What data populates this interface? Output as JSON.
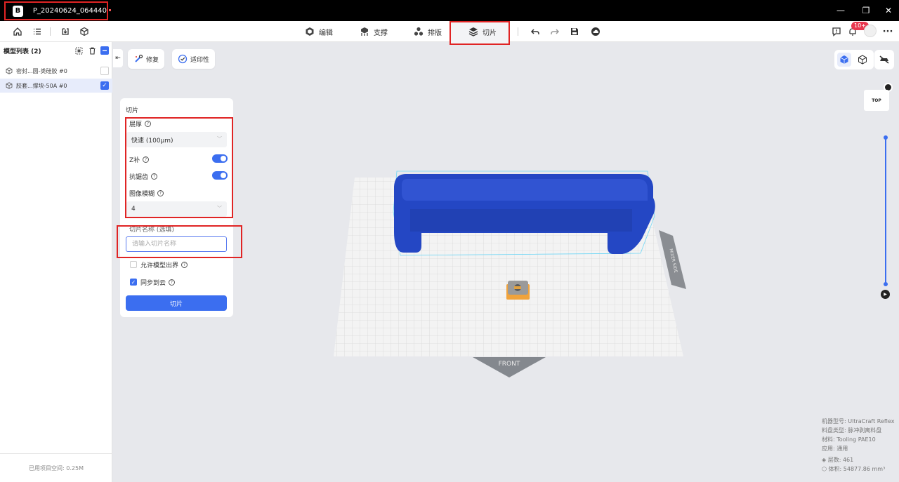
{
  "window": {
    "title": "P_20240624_064440",
    "logo": "B",
    "min_label": "—",
    "max_label": "❐",
    "close_label": "✕"
  },
  "toolbar": {
    "tabs": [
      {
        "label": "编辑",
        "icon": "edit-icon"
      },
      {
        "label": "支撑",
        "icon": "support-icon"
      },
      {
        "label": "排版",
        "icon": "layout-icon"
      },
      {
        "label": "切片",
        "icon": "slice-icon",
        "active": true
      }
    ],
    "notification_count": "10+",
    "more_label": "···"
  },
  "sidebar": {
    "title": "模型列表 (2)",
    "items": [
      {
        "label": "密封...圆-类硅胶 #0",
        "checked": false
      },
      {
        "label": "胶套...撑块-50A #0",
        "checked": true
      }
    ],
    "footer": "已用项目空间: 0.25M"
  },
  "actions": {
    "repair_label": "修复",
    "printability_label": "适印性"
  },
  "slice_panel": {
    "title": "切片",
    "layer_thickness_label": "层厚",
    "layer_thickness_value": "快速 (100μm)",
    "z_comp_label": "Z补",
    "z_comp_on": true,
    "antialias_label": "抗锯齿",
    "antialias_on": true,
    "image_blur_label": "图像模糊",
    "image_blur_value": "4",
    "slice_name_label": "切片名称 (选填)",
    "slice_name_placeholder": "请输入切片名称",
    "slice_name_value": "",
    "allow_out_of_bounds_label": "允许模型出界",
    "allow_out_of_bounds": false,
    "sync_cloud_label": "同步到云",
    "sync_cloud": true,
    "slice_button": "切片"
  },
  "viewport": {
    "front_label": "FRONT",
    "side_label": "MIXER SIDE",
    "cube_label": "TOP",
    "model_color": "#2447c4",
    "accent": "#3b6ef0"
  },
  "info": {
    "machine_label": "机器型号:",
    "machine_value": "UltraCraft Reflex",
    "tray_label": "料盘类型:",
    "tray_value": "脉冲剥离料盘",
    "material_label": "材料:",
    "material_value": "Tooling PAE10",
    "application_label": "应用:",
    "application_value": "通用",
    "layers_label": "层数:",
    "layers_value": "461",
    "volume_label": "体积:",
    "volume_value": "54877.86 mm³"
  }
}
